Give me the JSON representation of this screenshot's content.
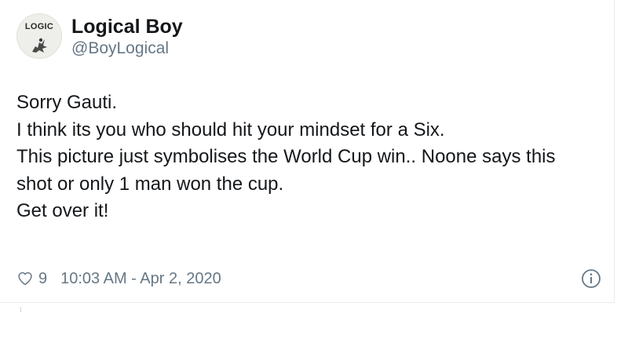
{
  "tweet": {
    "avatar_text": "LOGIC",
    "display_name": "Logical Boy",
    "handle": "@BoyLogical",
    "text_lines": [
      "Sorry Gauti.",
      "I think its you who should hit your mindset for a Six.",
      "This picture just symbolises the World Cup win.. Noone says this",
      "shot or only 1 man won the cup.",
      "Get over it!"
    ],
    "like_count": "9",
    "timestamp": "10:03 AM - Apr 2, 2020"
  },
  "icons": {
    "like": "heart-icon",
    "info": "info-icon"
  },
  "colors": {
    "text_primary": "#14171a",
    "text_secondary": "#657786",
    "border": "#e6ecf0"
  }
}
